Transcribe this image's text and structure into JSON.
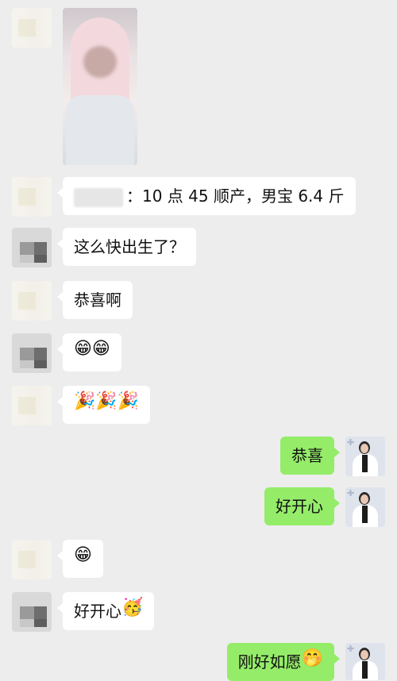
{
  "messages": [
    {
      "side": "in",
      "avatar": "cream-blurred",
      "type": "image",
      "image_desc": "newborn-baby-photo"
    },
    {
      "side": "in",
      "avatar": "cream-blurred",
      "type": "text",
      "text": "：10 点 45 顺产，男宝 6.4 斤",
      "has_redacted_name": true
    },
    {
      "side": "in",
      "avatar": "gray-blurred",
      "type": "text",
      "text": "这么快出生了？"
    },
    {
      "side": "in",
      "avatar": "cream-blurred",
      "type": "text",
      "text": "恭喜啊"
    },
    {
      "side": "in",
      "avatar": "gray-blurred",
      "type": "emoji",
      "emoji": "😁😁"
    },
    {
      "side": "in",
      "avatar": "cream-blurred",
      "type": "emoji",
      "emoji": "🎉🎉🎉"
    },
    {
      "side": "out",
      "avatar": "woman",
      "type": "text",
      "text": "恭喜"
    },
    {
      "side": "out",
      "avatar": "woman",
      "type": "text",
      "text": "好开心"
    },
    {
      "side": "in",
      "avatar": "cream-blurred",
      "type": "emoji",
      "emoji": "😁"
    },
    {
      "side": "in",
      "avatar": "gray-blurred",
      "type": "text",
      "text": "好开心",
      "emoji": "🥳"
    },
    {
      "side": "out",
      "avatar": "woman",
      "type": "text",
      "text": "刚好如愿",
      "emoji": "🤭"
    }
  ]
}
